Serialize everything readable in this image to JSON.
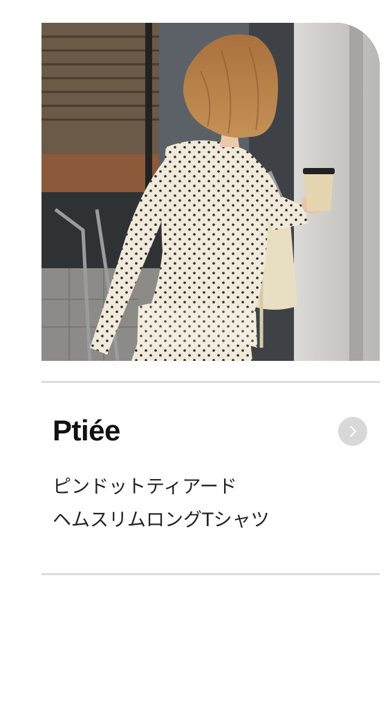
{
  "product": {
    "brand": "Ptiée",
    "name_line1": "ピンドットティアード",
    "name_line2": "ヘムスリムロングTシャツ",
    "arrow_icon": "chevron-right-icon"
  },
  "colors": {
    "background": "#ffffff",
    "divider": "#dcdcdc",
    "arrow_button": "#d8d8d8",
    "brand_text": "#111111"
  }
}
